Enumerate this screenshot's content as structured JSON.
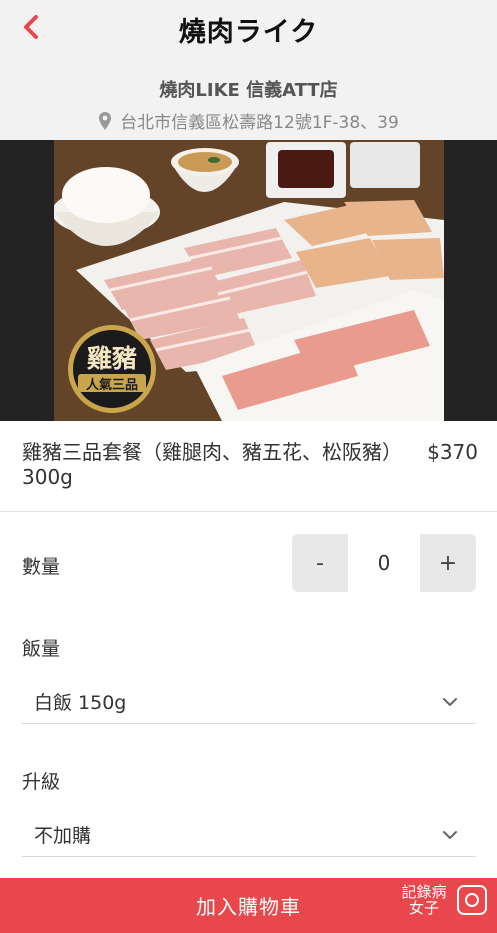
{
  "header": {
    "logo_text": "燒肉ライク",
    "store_name": "燒肉LIKE 信義ATT店",
    "address": "台北市信義區松壽路12號1F-38、39",
    "address_icon": "map-pin-icon",
    "back_icon": "chevron-left-icon"
  },
  "hero": {
    "badge_top": "雞豬",
    "badge_bottom": "人氣三品"
  },
  "product": {
    "name": "雞豬三品套餐（雞腿肉、豬五花、松阪豬）300g",
    "price": "$370"
  },
  "quantity": {
    "label": "數量",
    "decrement": "-",
    "value": "0",
    "increment": "+"
  },
  "rice": {
    "label": "飯量",
    "selected": "白飯 150g"
  },
  "upgrade": {
    "label": "升級",
    "selected": "不加購"
  },
  "cart": {
    "label": "加入購物車"
  },
  "watermark": {
    "line1": "記錄病",
    "line2": "女子"
  },
  "colors": {
    "accent": "#e8474c",
    "header_bg": "#f2f2f2"
  }
}
